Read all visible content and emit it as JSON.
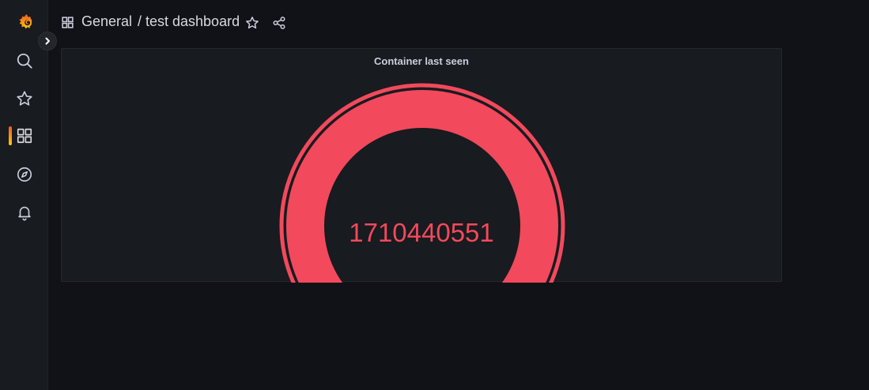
{
  "sidebar": {
    "items": [
      {
        "name": "grafana-logo-icon"
      },
      {
        "name": "search-icon"
      },
      {
        "name": "starred-icon"
      },
      {
        "name": "dashboards-icon",
        "active": true
      },
      {
        "name": "explore-compass-icon"
      },
      {
        "name": "alerting-bell-icon"
      }
    ],
    "expand_icon": "chevron-right-icon"
  },
  "breadcrumb": {
    "icon": "dashboard-grid-icon",
    "folder": "General",
    "title": "/ test dashboard",
    "star_icon": "star-icon",
    "share_icon": "share-icon"
  },
  "panel": {
    "title": "Container last seen",
    "value": "1710440551",
    "gauge_fraction": 1.0,
    "color": "#F2495C"
  },
  "colors": {
    "background": "#111217",
    "panel": "#181B1F",
    "accent": "#F2495C",
    "brand": "#F05A28"
  }
}
